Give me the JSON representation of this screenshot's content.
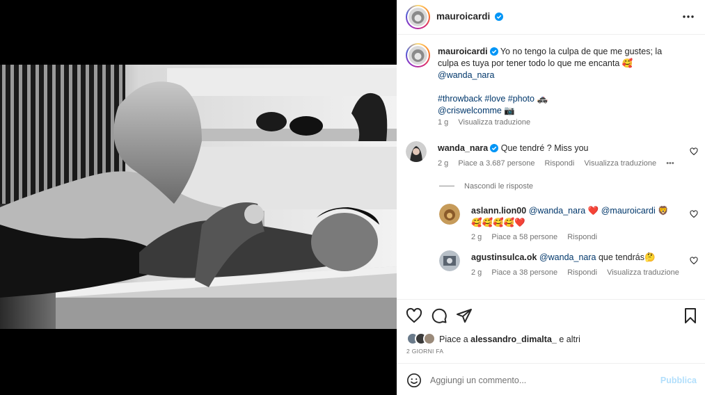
{
  "post": {
    "username": "mauroicardi",
    "verified": true
  },
  "caption": {
    "username": "mauroicardi",
    "text": "Yo no tengo la culpa de que me gustes; la culpa es tuya por tener todo lo que me encanta 🥰",
    "mention": "@wanda_nara",
    "hashtags": "#throwback #love #photo 🚓",
    "credit": "@criswelcomme 📷",
    "time": "1 g",
    "translate": "Visualizza traduzione"
  },
  "comments": [
    {
      "username": "wanda_nara",
      "verified": true,
      "text": "Que tendré ? Miss you",
      "time": "2 g",
      "likes": "Piace a 3.687 persone",
      "reply": "Rispondi",
      "translate": "Visualizza traduzione",
      "more": "•••"
    }
  ],
  "hide_replies": "Nascondi le risposte",
  "replies": [
    {
      "username": "aslann.lion00",
      "mention1": "@wanda_nara",
      "heart": "❤️",
      "mention2": "@mauroicardi",
      "emoji_after": "🦁",
      "line2": "🥰🥰🥰🥰❤️",
      "time": "2 g",
      "likes": "Piace a 58 persone",
      "reply": "Rispondi"
    },
    {
      "username": "agustinsulca.ok",
      "mention": "@wanda_nara",
      "text": "que tendrás🤔",
      "time": "2 g",
      "likes": "Piace a 38 persone",
      "reply": "Rispondi",
      "translate": "Visualizza traduzione"
    }
  ],
  "likes_bar": {
    "prefix": "Piace a ",
    "user": "alessandro_dimalta_",
    "suffix": " e altri"
  },
  "date": "2 GIORNI FA",
  "comment_box": {
    "placeholder": "Aggiungi un commento...",
    "publish": "Pubblica"
  },
  "icons": {
    "more": "more-horizontal-icon",
    "like": "heart-icon",
    "comment": "comment-bubble-icon",
    "share": "paper-plane-icon",
    "save": "bookmark-icon",
    "emoji": "smiley-icon",
    "verified": "verified-badge-icon"
  },
  "colors": {
    "verified": "#0095f6",
    "link": "#00376b",
    "muted": "#737373",
    "publish_disabled": "#b2dffc"
  }
}
